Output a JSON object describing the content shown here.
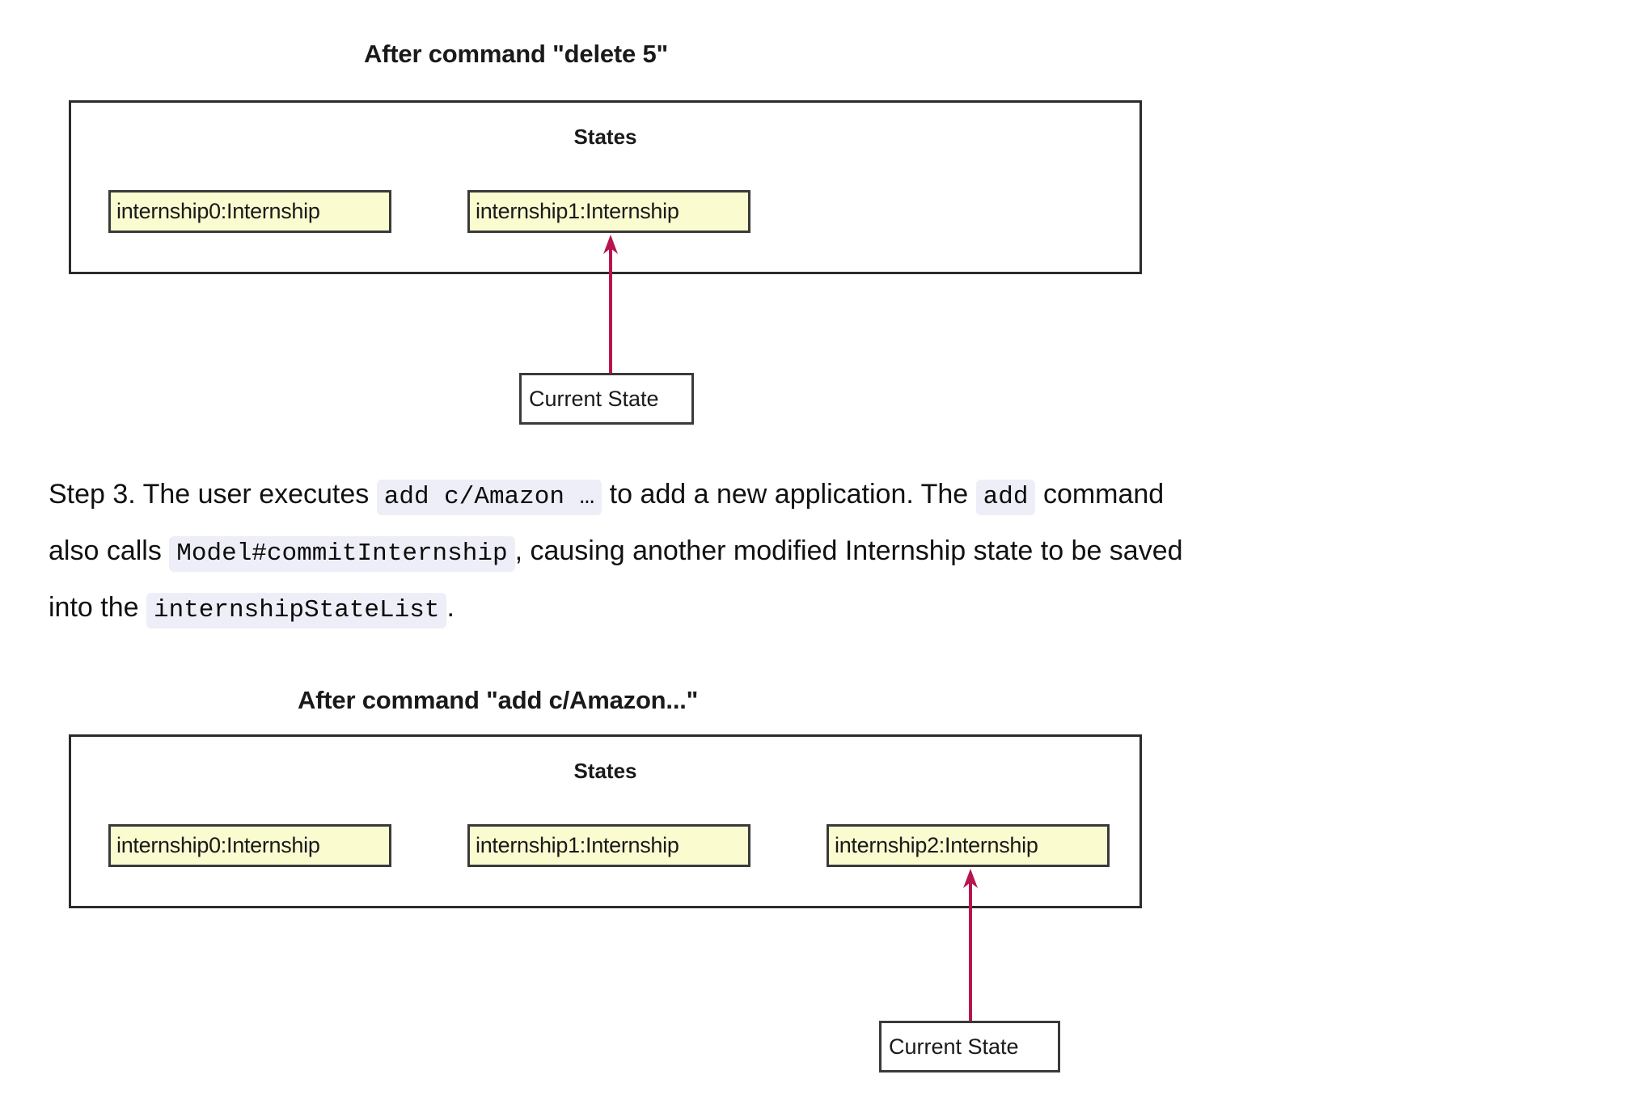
{
  "diagram1": {
    "title": "After command \"delete 5\"",
    "frame_label": "States",
    "states": [
      {
        "label": "internship0:Internship"
      },
      {
        "label": "internship1:Internship"
      }
    ],
    "note": "Current State",
    "pointer_target_index": 1,
    "arrow_color": "#b81550"
  },
  "paragraph": {
    "segments": [
      {
        "type": "text",
        "value": "Step 3. The user executes "
      },
      {
        "type": "code",
        "value": "add c/Amazon …"
      },
      {
        "type": "text",
        "value": " to add a new application. The "
      },
      {
        "type": "code",
        "value": "add"
      },
      {
        "type": "text",
        "value": " command also calls "
      },
      {
        "type": "code",
        "value": "Model#commitInternship"
      },
      {
        "type": "text",
        "value": ", causing another modified Internship state to be saved into the "
      },
      {
        "type": "code",
        "value": "internshipStateList"
      },
      {
        "type": "text",
        "value": "."
      }
    ],
    "line1_text_a": "Step 3. The user executes",
    "line1_code_a": "add c/Amazon …",
    "line1_text_b": "to add a new application. The",
    "line1_code_b": "add",
    "line1_text_c": "command",
    "line2_text_a": "also calls",
    "line2_code_a": "Model#commitInternship",
    "line2_text_b": ", causing another modified Internship state to be saved",
    "line3_text_a": "into the",
    "line3_code_a": "internshipStateList",
    "line3_text_b": "."
  },
  "diagram2": {
    "title": "After command \"add c/Amazon...\"",
    "frame_label": "States",
    "states": [
      {
        "label": "internship0:Internship"
      },
      {
        "label": "internship1:Internship"
      },
      {
        "label": "internship2:Internship"
      }
    ],
    "note": "Current State",
    "pointer_target_index": 2,
    "arrow_color": "#b81550"
  },
  "colors": {
    "object_fill": "#fbfbd0",
    "object_border": "#3a3a3a",
    "frame_border": "#2b2b2b",
    "arrow": "#b81550",
    "code_background": "#eeeef8",
    "page_background": "#ffffff"
  }
}
